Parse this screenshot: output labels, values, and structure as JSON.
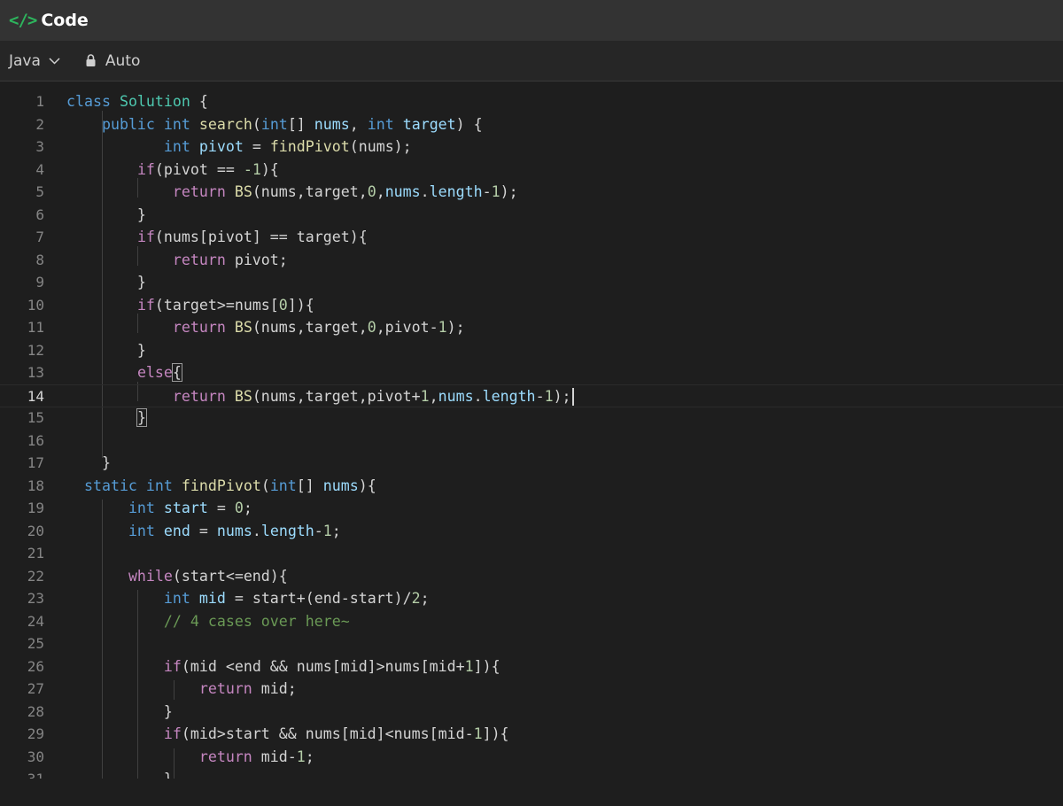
{
  "header": {
    "icon": "code-icon",
    "title": "Code"
  },
  "toolbar": {
    "language": "Java",
    "mode": "Auto",
    "lock_icon": "lock-icon",
    "chevron_icon": "chevron-down-icon"
  },
  "editor": {
    "active_line": 14,
    "lines": [
      [
        [
          "class ",
          "kw"
        ],
        [
          "Solution",
          "ty"
        ],
        [
          " {",
          ""
        ]
      ],
      [
        [
          "    ",
          ""
        ],
        [
          "public ",
          "kw"
        ],
        [
          "int ",
          "kw"
        ],
        [
          "search",
          "fn"
        ],
        [
          "(",
          ""
        ],
        [
          "int",
          "kw"
        ],
        [
          "[] ",
          ""
        ],
        [
          "nums",
          "var"
        ],
        [
          ", ",
          ""
        ],
        [
          "int ",
          "kw"
        ],
        [
          "target",
          "var"
        ],
        [
          ") {",
          ""
        ]
      ],
      [
        [
          "           ",
          ""
        ],
        [
          "int ",
          "kw"
        ],
        [
          "pivot",
          "var"
        ],
        [
          " = ",
          ""
        ],
        [
          "findPivot",
          "fn"
        ],
        [
          "(nums);",
          ""
        ]
      ],
      [
        [
          "        ",
          ""
        ],
        [
          "if",
          "ctl"
        ],
        [
          "(pivot == ",
          ""
        ],
        [
          "-1",
          "num"
        ],
        [
          "){",
          ""
        ]
      ],
      [
        [
          "            ",
          ""
        ],
        [
          "return ",
          "ctl"
        ],
        [
          "BS",
          "fn"
        ],
        [
          "(nums,target,",
          ""
        ],
        [
          "0",
          "num"
        ],
        [
          ",",
          ""
        ],
        [
          "nums",
          "var"
        ],
        [
          ".",
          ""
        ],
        [
          "length",
          "var"
        ],
        [
          "-",
          ""
        ],
        [
          "1",
          "num"
        ],
        [
          ");",
          ""
        ]
      ],
      [
        [
          "        }",
          ""
        ]
      ],
      [
        [
          "        ",
          ""
        ],
        [
          "if",
          "ctl"
        ],
        [
          "(nums[pivot] == target){",
          ""
        ]
      ],
      [
        [
          "            ",
          ""
        ],
        [
          "return ",
          "ctl"
        ],
        [
          "pivot;",
          ""
        ]
      ],
      [
        [
          "        }",
          ""
        ]
      ],
      [
        [
          "        ",
          ""
        ],
        [
          "if",
          "ctl"
        ],
        [
          "(target>=nums[",
          ""
        ],
        [
          "0",
          "num"
        ],
        [
          "]){",
          ""
        ]
      ],
      [
        [
          "            ",
          ""
        ],
        [
          "return ",
          "ctl"
        ],
        [
          "BS",
          "fn"
        ],
        [
          "(nums,target,",
          ""
        ],
        [
          "0",
          "num"
        ],
        [
          ",pivot-",
          ""
        ],
        [
          "1",
          "num"
        ],
        [
          ");",
          ""
        ]
      ],
      [
        [
          "        }",
          ""
        ]
      ],
      [
        [
          "        ",
          ""
        ],
        [
          "else",
          "ctl"
        ],
        [
          "{",
          "bm"
        ]
      ],
      [
        [
          "            ",
          ""
        ],
        [
          "return ",
          "ctl"
        ],
        [
          "BS",
          "fn"
        ],
        [
          "(nums,target,pivot+",
          ""
        ],
        [
          "1",
          "num"
        ],
        [
          ",",
          ""
        ],
        [
          "nums",
          "var"
        ],
        [
          ".",
          ""
        ],
        [
          "length",
          "var"
        ],
        [
          "-",
          ""
        ],
        [
          "1",
          "num"
        ],
        [
          ");",
          ""
        ]
      ],
      [
        [
          "        ",
          ""
        ],
        [
          "}",
          "bm"
        ]
      ],
      [],
      [
        [
          "    }",
          ""
        ]
      ],
      [
        [
          "  ",
          ""
        ],
        [
          "static ",
          "kw"
        ],
        [
          "int ",
          "kw"
        ],
        [
          "findPivot",
          "fn"
        ],
        [
          "(",
          ""
        ],
        [
          "int",
          "kw"
        ],
        [
          "[] ",
          ""
        ],
        [
          "nums",
          "var"
        ],
        [
          "){",
          ""
        ]
      ],
      [
        [
          "       ",
          ""
        ],
        [
          "int ",
          "kw"
        ],
        [
          "start",
          "var"
        ],
        [
          " = ",
          ""
        ],
        [
          "0",
          "num"
        ],
        [
          ";",
          ""
        ]
      ],
      [
        [
          "       ",
          ""
        ],
        [
          "int ",
          "kw"
        ],
        [
          "end",
          "var"
        ],
        [
          " = ",
          ""
        ],
        [
          "nums",
          "var"
        ],
        [
          ".",
          ""
        ],
        [
          "length",
          "var"
        ],
        [
          "-",
          ""
        ],
        [
          "1",
          "num"
        ],
        [
          ";",
          ""
        ]
      ],
      [],
      [
        [
          "       ",
          ""
        ],
        [
          "while",
          "ctl"
        ],
        [
          "(start<=end){",
          ""
        ]
      ],
      [
        [
          "           ",
          ""
        ],
        [
          "int ",
          "kw"
        ],
        [
          "mid",
          "var"
        ],
        [
          " = start+(end-start)/",
          ""
        ],
        [
          "2",
          "num"
        ],
        [
          ";",
          ""
        ]
      ],
      [
        [
          "           ",
          ""
        ],
        [
          "// 4 cases over here~",
          "cm"
        ]
      ],
      [],
      [
        [
          "           ",
          ""
        ],
        [
          "if",
          "ctl"
        ],
        [
          "(mid <end && nums[mid]>nums[mid+",
          ""
        ],
        [
          "1",
          "num"
        ],
        [
          "]){",
          ""
        ]
      ],
      [
        [
          "               ",
          ""
        ],
        [
          "return ",
          "ctl"
        ],
        [
          "mid;",
          ""
        ]
      ],
      [
        [
          "           }",
          ""
        ]
      ],
      [
        [
          "           ",
          ""
        ],
        [
          "if",
          "ctl"
        ],
        [
          "(mid>start && nums[mid]<nums[mid-",
          ""
        ],
        [
          "1",
          "num"
        ],
        [
          "]){",
          ""
        ]
      ],
      [
        [
          "               ",
          ""
        ],
        [
          "return ",
          "ctl"
        ],
        [
          "mid-",
          ""
        ],
        [
          "1",
          "num"
        ],
        [
          ";",
          ""
        ]
      ],
      [
        [
          "           }",
          ""
        ]
      ]
    ]
  }
}
